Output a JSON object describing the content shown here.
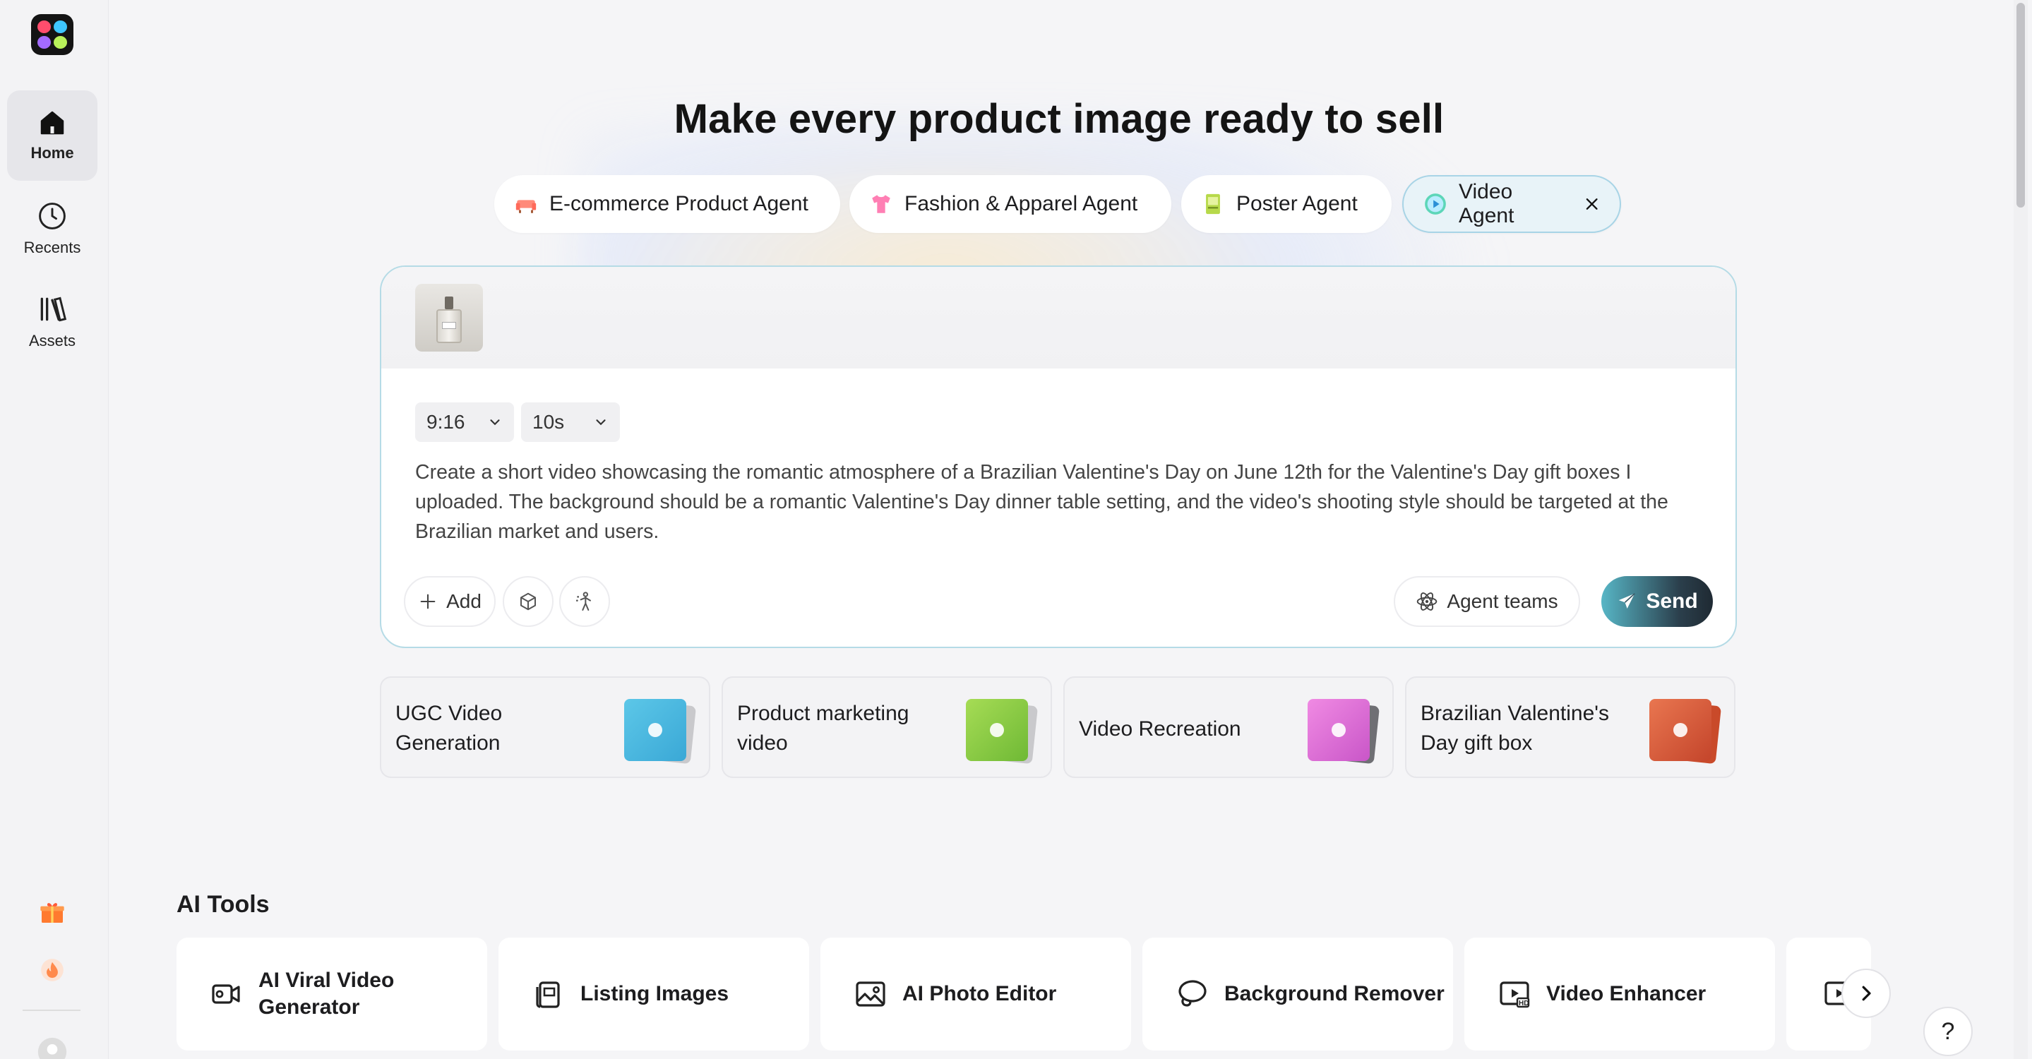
{
  "sidebar": {
    "items": [
      {
        "label": "Home",
        "icon": "home-icon",
        "active": true
      },
      {
        "label": "Recents",
        "icon": "clock-icon",
        "active": false
      },
      {
        "label": "Assets",
        "icon": "library-icon",
        "active": false
      }
    ],
    "bottom_icons": [
      "gift-icon",
      "flame-icon",
      "avatar"
    ]
  },
  "headline": "Make every product image ready to sell",
  "agents": [
    {
      "label": "E-commerce Product Agent",
      "icon": "sofa-icon",
      "selected": false
    },
    {
      "label": "Fashion & Apparel Agent",
      "icon": "shirt-icon",
      "selected": false
    },
    {
      "label": "Poster Agent",
      "icon": "poster-icon",
      "selected": false
    },
    {
      "label": "Video Agent",
      "icon": "play-icon",
      "selected": true
    }
  ],
  "prompt": {
    "aspect_ratio": "9:16",
    "duration": "10s",
    "text": "Create a short video showcasing the romantic atmosphere of a Brazilian Valentine's Day on June 12th for the Valentine's Day gift boxes I uploaded. The background should be a romantic Valentine's Day dinner table setting, and the video's shooting style should be targeted at the Brazilian market and users.",
    "add_label": "Add",
    "agent_teams_label": "Agent teams",
    "send_label": "Send",
    "attachment": "perfume-bottle-thumbnail"
  },
  "templates": [
    {
      "title": "UGC Video Generation",
      "thumb_color": "#5cc7e8"
    },
    {
      "title": "Product marketing video",
      "thumb_color": "#8bd04a"
    },
    {
      "title": "Video Recreation",
      "thumb_color": "#e36fd9"
    },
    {
      "title": "Brazilian Valentine's Day gift box",
      "thumb_color": "#e0603b"
    }
  ],
  "ai_tools": {
    "title": "AI Tools",
    "items": [
      {
        "label": "AI Viral Video Generator",
        "icon": "video-camera-icon"
      },
      {
        "label": "Listing Images",
        "icon": "images-stack-icon"
      },
      {
        "label": "AI Photo Editor",
        "icon": "photo-icon"
      },
      {
        "label": "Background Remover",
        "icon": "lasso-icon"
      },
      {
        "label": "Video Enhancer",
        "icon": "hd-video-icon"
      }
    ]
  },
  "help_label": "?"
}
